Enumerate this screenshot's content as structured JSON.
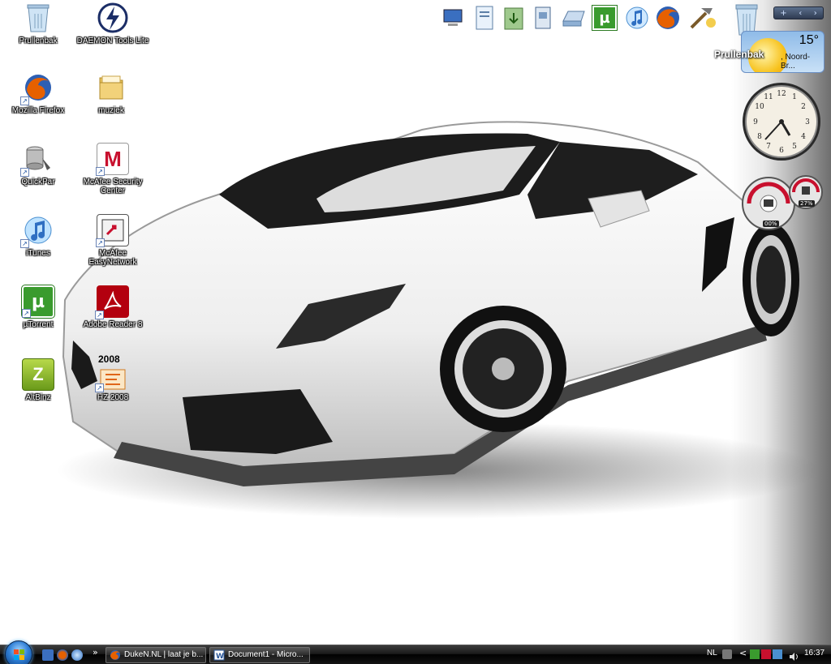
{
  "desktop_icons": [
    {
      "key": "prullenbak",
      "label": "Prullenbak",
      "icon": "recycle-bin-icon"
    },
    {
      "key": "daemon",
      "label": "DAEMON Tools Lite",
      "icon": "daemon-tools-icon"
    },
    {
      "key": "firefox",
      "label": "Mozilla Firefox",
      "icon": "firefox-icon"
    },
    {
      "key": "muziek",
      "label": "muziek",
      "icon": "folder-icon"
    },
    {
      "key": "quickpar",
      "label": "QuickPar",
      "icon": "quickpar-icon"
    },
    {
      "key": "mcafee_sc",
      "label": "McAfee Security Center",
      "icon": "mcafee-icon"
    },
    {
      "key": "itunes",
      "label": "iTunes",
      "icon": "itunes-icon"
    },
    {
      "key": "mcafee_en",
      "label": "McAfee EasyNetwork",
      "icon": "mcafee-easynetwork-icon"
    },
    {
      "key": "utorrent",
      "label": "µTorrent",
      "icon": "utorrent-icon"
    },
    {
      "key": "adobe",
      "label": "Adobe Reader 8",
      "icon": "adobe-reader-icon"
    },
    {
      "key": "altbinz",
      "label": "AltBinz",
      "icon": "altbinz-icon"
    },
    {
      "key": "hz2008",
      "label": "HZ 2008",
      "icon": "hz2008-icon",
      "badge": "2008"
    }
  ],
  "dock": [
    {
      "icon": "computer-icon"
    },
    {
      "icon": "documents-icon"
    },
    {
      "icon": "downloads-icon"
    },
    {
      "icon": "documents-2-icon"
    },
    {
      "icon": "drive-icon"
    },
    {
      "icon": "utorrent-icon",
      "glyph": "µ"
    },
    {
      "icon": "itunes-icon"
    },
    {
      "icon": "firefox-icon"
    },
    {
      "icon": "tools-icon"
    },
    {
      "icon": "recycle-bin-icon"
    }
  ],
  "sidebar": {
    "recycle_label": "Prullenbak",
    "weather": {
      "temp": "15°",
      "location": ", Noord-Br..."
    },
    "meter": {
      "cpu": "00%",
      "mem": "27%"
    }
  },
  "taskbar": {
    "tasks": [
      {
        "label": "DukeN.NL | laat je b...",
        "icon": "firefox-icon"
      },
      {
        "label": "Document1 - Micro...",
        "icon": "word-icon"
      }
    ],
    "overflow": "»",
    "tray_lang": "NL",
    "tray_chevron": "<",
    "clock": "16:37"
  },
  "colors": {
    "utorrent": "#3a9b2e",
    "mcafee": "#c8102e",
    "firefox_orange": "#e66000",
    "taskbar": "#000000"
  }
}
